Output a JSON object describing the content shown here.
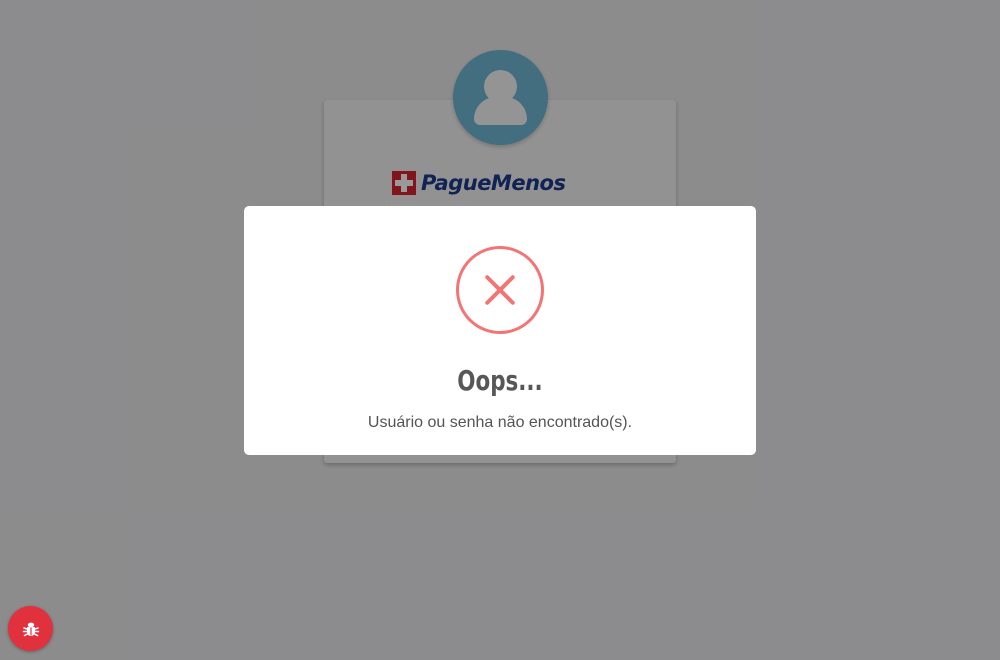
{
  "brand": {
    "name": "PagueMenos",
    "accent_color": "#1d3b8b",
    "cross_color": "#d7242d"
  },
  "avatar": {
    "icon": "user-icon",
    "color": "#6fb8d4"
  },
  "modal": {
    "icon": "error-x-icon",
    "icon_color": "#f27474",
    "title": "Oops...",
    "message": "Usuário ou senha não encontrado(s)."
  },
  "bug_report": {
    "icon": "bug-icon",
    "color": "#e0313d"
  }
}
